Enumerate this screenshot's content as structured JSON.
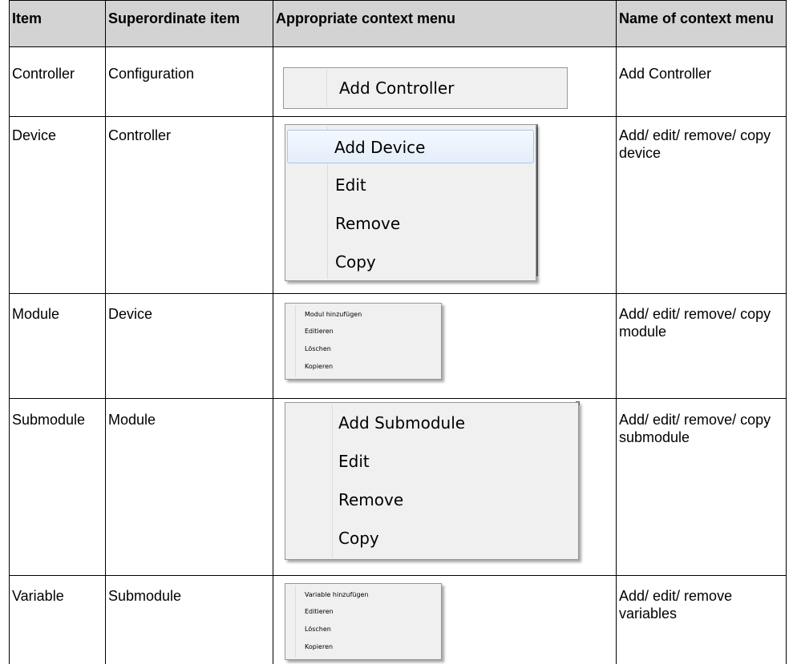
{
  "table": {
    "headers": {
      "item": "Item",
      "superordinate": "Superordinate item",
      "context_menu": "Appropriate context menu",
      "menu_name": "Name of context menu"
    },
    "rows": [
      {
        "item": "Controller",
        "superordinate": "Configuration",
        "menu_items": [
          "Add Controller"
        ],
        "name": "Add Controller"
      },
      {
        "item": "Device",
        "superordinate": "Controller",
        "menu_items": [
          "Add Device",
          "Edit",
          "Remove",
          "Copy"
        ],
        "name": "Add/ edit/ remove/ copy device"
      },
      {
        "item": "Module",
        "superordinate": "Device",
        "menu_items": [
          "Modul hinzufügen",
          "Editieren",
          "Löschen",
          "Kopieren"
        ],
        "name": "Add/ edit/ remove/ copy module"
      },
      {
        "item": "Submodule",
        "superordinate": "Module",
        "menu_items": [
          "Add Submodule",
          "Edit",
          "Remove",
          "Copy"
        ],
        "name": "Add/ edit/ remove/ copy submodule"
      },
      {
        "item": "Variable",
        "superordinate": "Submodule",
        "menu_items": [
          "Variable hinzufügen",
          "Editieren",
          "Löschen",
          "Kopieren"
        ],
        "name": "Add/ edit/ remove variables"
      }
    ]
  },
  "colors": {
    "header_bg": "#d3d3d3",
    "grid": "#000000",
    "menu_bg": "#f0f0f0",
    "menu_highlight_border": "#a8c8ec"
  }
}
